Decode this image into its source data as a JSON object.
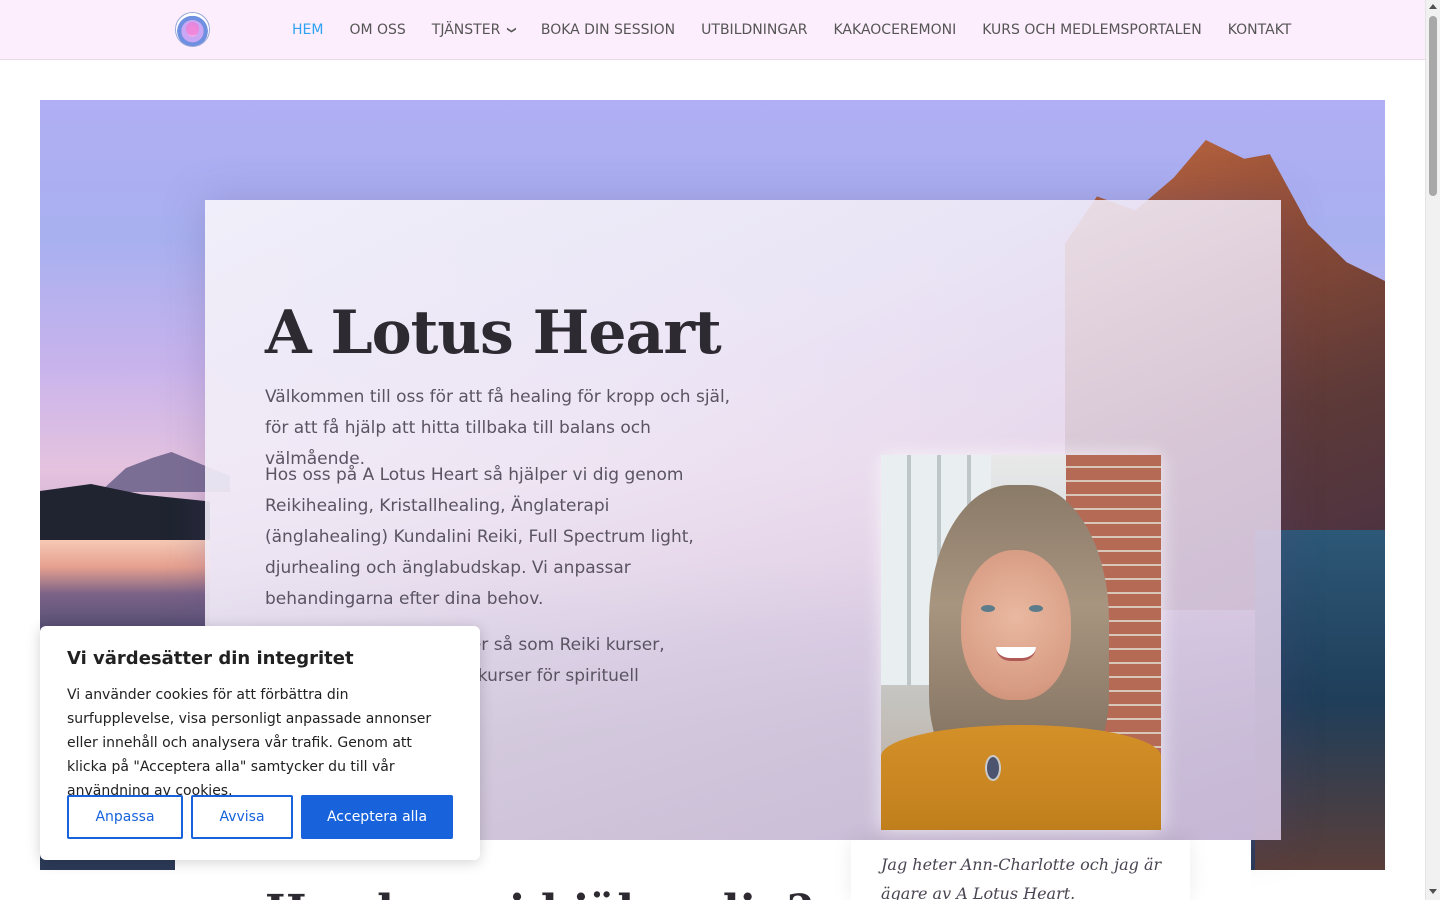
{
  "header": {
    "nav": [
      {
        "label": "HEM",
        "active": true
      },
      {
        "label": "OM OSS"
      },
      {
        "label": "TJÄNSTER",
        "dropdown": true
      },
      {
        "label": "BOKA DIN SESSION"
      },
      {
        "label": "UTBILDNINGAR"
      },
      {
        "label": "KAKAOCEREMONI"
      },
      {
        "label": "KURS OCH MEDLEMSPORTALEN"
      },
      {
        "label": "KONTAKT"
      }
    ],
    "active_color": "#2ea3f2"
  },
  "hero": {
    "title": "A Lotus Heart",
    "lead": "Välkommen till oss för att få healing för kropp och själ, för att få hjälp att hitta tillbaka till balans och välmående.",
    "body": "Hos oss på A Lotus Heart så hjälper vi dig genom Reikihealing, Kristallhealing, Änglaterapi (änglahealing) Kundalini Reiki, Full Spectrum light, djurhealing och änglabudskap. Vi anpassar behandingarna efter dina behov.",
    "body2": "rser så som Reiki kurser, ra kurser för spirituell"
  },
  "caption": {
    "text": "Jag heter Ann-Charlotte och jag är ägare av A Lotus Heart."
  },
  "lower": {
    "title": "Hur kan vi hjälpa dig?"
  },
  "cookie": {
    "title": "Vi värdesätter din integritet",
    "text": "Vi använder cookies för att förbättra din surfupplevelse, visa personligt anpassade annonser eller innehåll och analysera vår trafik. Genom att klicka på \"Acceptera alla\" samtycker du till vår användning av cookies.",
    "customize_label": "Anpassa",
    "reject_label": "Avvisa",
    "accept_label": "Acceptera alla",
    "accent_color": "#1863dc"
  }
}
